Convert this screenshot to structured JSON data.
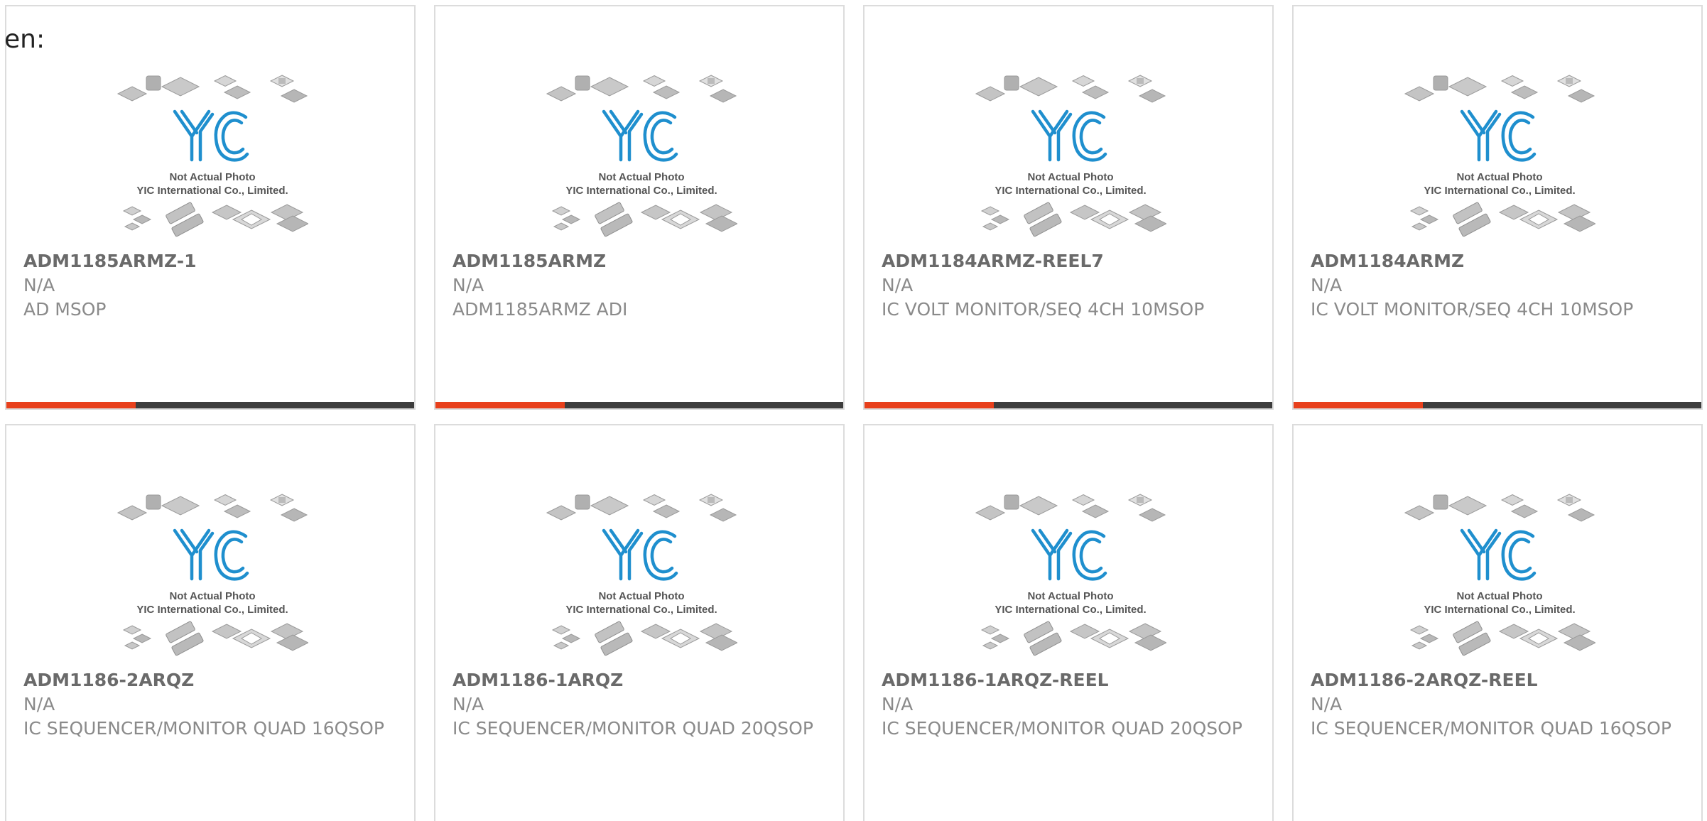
{
  "lang_label": "en:",
  "colors": {
    "accent": "#e8401c",
    "bar": "#3d3d3d",
    "logo_blue": "#1f8fce"
  },
  "placeholder_image": {
    "logo": "YIC",
    "line1": "Not Actual Photo",
    "line2": "YIC International Co., Limited."
  },
  "products": [
    {
      "part": "ADM1185ARMZ-1",
      "mfr": "N/A",
      "desc": "AD MSOP"
    },
    {
      "part": "ADM1185ARMZ",
      "mfr": "N/A",
      "desc": "ADM1185ARMZ ADI"
    },
    {
      "part": "ADM1184ARMZ-REEL7",
      "mfr": "N/A",
      "desc": "IC VOLT MONITOR/SEQ 4CH 10MSOP"
    },
    {
      "part": "ADM1184ARMZ",
      "mfr": "N/A",
      "desc": "IC VOLT MONITOR/SEQ 4CH 10MSOP"
    },
    {
      "part": "ADM1186-2ARQZ",
      "mfr": "N/A",
      "desc": "IC SEQUENCER/MONITOR QUAD 16QSOP"
    },
    {
      "part": "ADM1186-1ARQZ",
      "mfr": "N/A",
      "desc": "IC SEQUENCER/MONITOR QUAD 20QSOP"
    },
    {
      "part": "ADM1186-1ARQZ-REEL",
      "mfr": "N/A",
      "desc": "IC SEQUENCER/MONITOR QUAD 20QSOP"
    },
    {
      "part": "ADM1186-2ARQZ-REEL",
      "mfr": "N/A",
      "desc": "IC SEQUENCER/MONITOR QUAD 16QSOP"
    }
  ]
}
